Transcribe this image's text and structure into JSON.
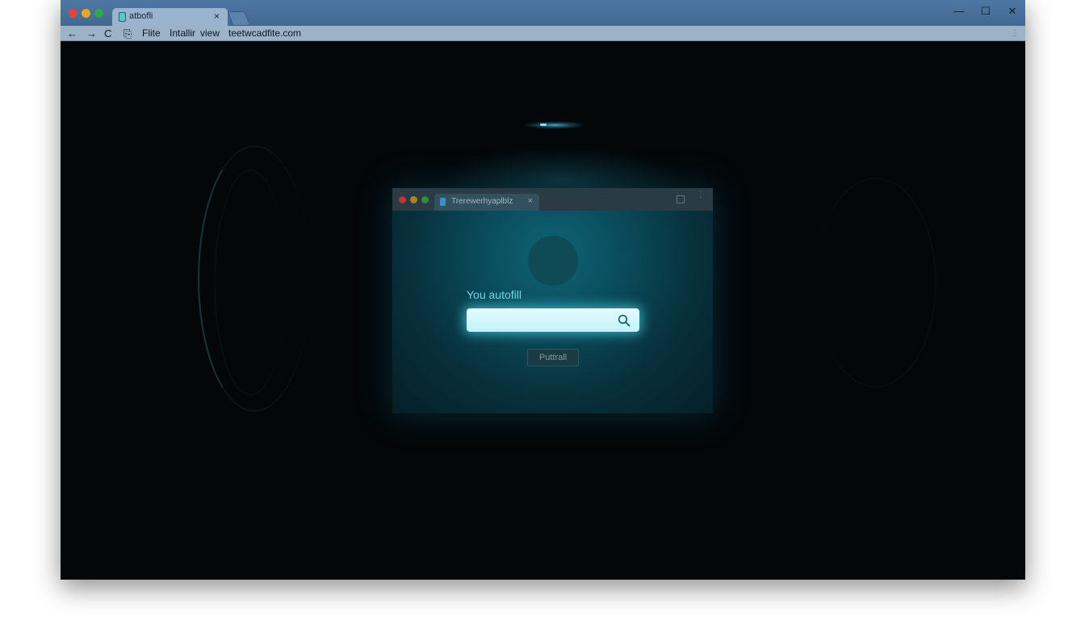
{
  "outer_browser": {
    "tab_title": "atbofli",
    "tab_close": "×",
    "window_controls": {
      "minimize": "—",
      "maximize": "☐",
      "close": "✕"
    },
    "toolbar": {
      "back": "←",
      "forward": "→",
      "reload": "C",
      "clipboard": "⎘",
      "menu_items": [
        "Flite",
        "Intallir",
        "view"
      ],
      "url": "teetwcadfite.com",
      "more": "⋮"
    }
  },
  "inner_window": {
    "tab_title": "Trerewerhyaplblz",
    "tab_close": "×",
    "kebab": "⋮",
    "autofill_label": "You autofill",
    "search": {
      "value": "",
      "placeholder": ""
    },
    "button_label": "Puttrall"
  },
  "colors": {
    "accent": "#6fd6e8",
    "titlebar": "#4a70a0",
    "background": "#03070a"
  },
  "icons": [
    "back-arrow-icon",
    "forward-arrow-icon",
    "reload-icon",
    "clipboard-icon",
    "search-icon",
    "close-icon"
  ]
}
